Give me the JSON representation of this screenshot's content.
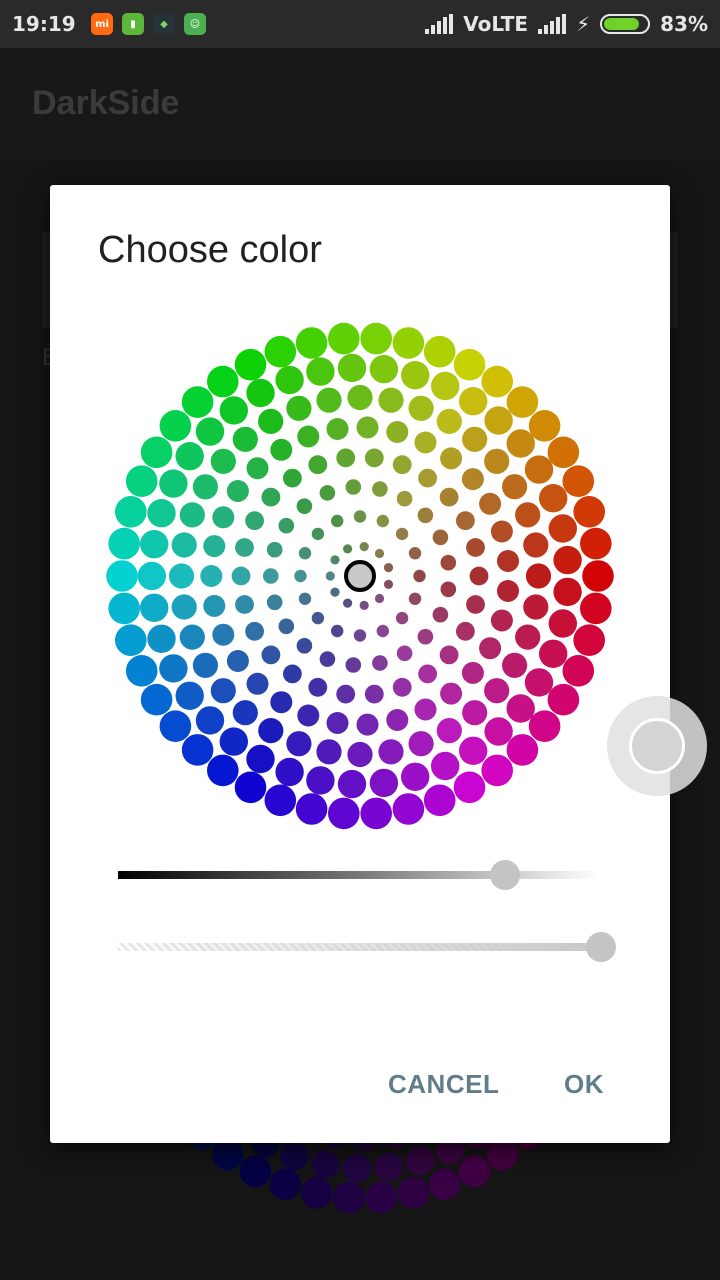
{
  "status_bar": {
    "time": "19:19",
    "network": "VoLTE",
    "battery_percent": "83%",
    "battery_level": 0.83,
    "notification_icons": [
      "mi-app-icon",
      "sim-icon",
      "android-icon",
      "android-robot-icon"
    ]
  },
  "app_bar": {
    "title": "DarkSide"
  },
  "background": {
    "partial_label": "E"
  },
  "dialog": {
    "title": "Choose color",
    "lightness_value": 0.8,
    "alpha_value": 1.0,
    "selected_color": "#c8c8c8",
    "buttons": {
      "cancel": "CANCEL",
      "ok": "OK"
    }
  },
  "fab": {
    "icon": "color-circle-icon"
  }
}
